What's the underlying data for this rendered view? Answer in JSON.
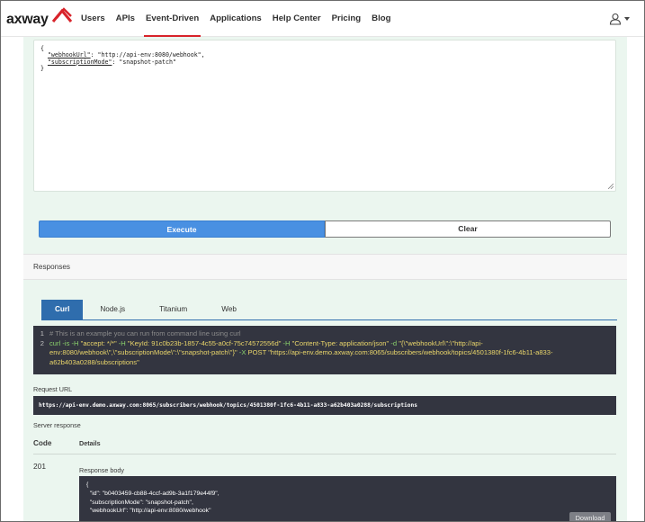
{
  "header": {
    "logo_text": "axway",
    "nav": [
      "Users",
      "APIs",
      "Event-Driven",
      "Applications",
      "Help Center",
      "Pricing",
      "Blog"
    ],
    "active_nav": "Event-Driven"
  },
  "request_body": {
    "open": "{",
    "line1_key": "\"webhookUrl\"",
    "line1_rest": ": \"http://api-env:8080/webhook\",",
    "line2_key": "\"subscriptionMode\"",
    "line2_rest": ": \"snapshot-patch\"",
    "close": "}"
  },
  "buttons": {
    "execute": "Execute",
    "clear": "Clear"
  },
  "responses": {
    "title": "Responses",
    "tabs": [
      "Curl",
      "Node.js",
      "Titanium",
      "Web"
    ],
    "active_tab": "Curl",
    "curl_line1_num": "1",
    "curl_line1": "# This is an example you can run from command line using curl",
    "curl_line2_num": "2",
    "curl_cmd": "curl",
    "curl_flag1": "-is -H",
    "curl_h1": "\"accept: */*\"",
    "curl_flag2": "-H",
    "curl_h2": "\"KeyId: 91c0b23b-1857-4c55-a0cf-75c74572556d\"",
    "curl_flag3": "-H",
    "curl_h3": "\"Content-Type: application/json\"",
    "curl_flag4": "-d",
    "curl_data": "\"{\\\"webhookUrl\\\":\\\"http://api-env:8080/webhook\\\",\\\"subscriptionMode\\\":\\\"snapshot-patch\\\"}\"",
    "curl_flag5": "-X",
    "curl_method": "POST",
    "curl_url": "\"https://api-env.demo.axway.com:8065/subscribers/webhook/topics/4501380f-1fc6-4b11-a833-a62b403a0288/subscriptions\"",
    "request_url_label": "Request URL",
    "request_url": "https://api-env.demo.axway.com:8065/subscribers/webhook/topics/4501380f-1fc6-4b11-a833-a62b403a0288/subscriptions",
    "server_response_label": "Server response",
    "col_code": "Code",
    "col_details": "Details",
    "status_code": "201",
    "response_body_label": "Response body",
    "response_body": "{\n  \"id\": \"b0403459-cb88-4ccf-ad9b-3a1f179e44f9\",\n  \"subscriptionMode\": \"snapshot-patch\",\n  \"webhookUrl\": \"http://api-env:8080/webhook\"",
    "download": "Download"
  }
}
